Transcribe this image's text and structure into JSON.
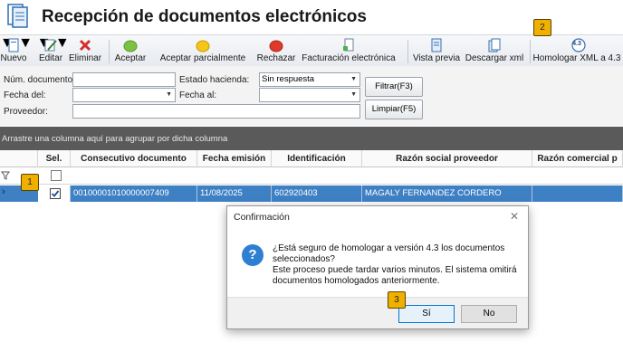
{
  "app": {
    "title": "Recepción de documentos electrónicos"
  },
  "toolbar": {
    "items": [
      {
        "label": "Nuevo",
        "icon": "new-document-icon"
      },
      {
        "label": "Editar",
        "icon": "edit-icon"
      },
      {
        "label": "Eliminar",
        "icon": "delete-icon"
      },
      {
        "label": "Aceptar",
        "icon": "green-circle-icon"
      },
      {
        "label": "Aceptar parcialmente",
        "icon": "yellow-circle-icon"
      },
      {
        "label": "Rechazar",
        "icon": "red-circle-icon"
      },
      {
        "label": "Facturación electrónica",
        "icon": "invoice-icon"
      },
      {
        "label": "Vista previa",
        "icon": "preview-icon"
      },
      {
        "label": "Descargar xml",
        "icon": "download-xml-icon"
      },
      {
        "label": "Homologar XML a 4.3",
        "icon": "homologate-icon",
        "icon_text": "4.3"
      }
    ]
  },
  "filters": {
    "num_documento_label": "Núm. documento:",
    "num_documento_value": "",
    "estado_label": "Estado hacienda:",
    "estado_value": "Sin respuesta",
    "fecha_del_label": "Fecha del:",
    "fecha_del_value": "",
    "fecha_al_label": "Fecha al:",
    "fecha_al_value": "",
    "proveedor_label": "Proveedor:",
    "proveedor_value": "",
    "filtrar_label": "Filtrar(F3)",
    "limpiar_label": "Limpiar(F5)"
  },
  "groupbar": {
    "text": "Arrastre una columna aquí para agrupar por dicha columna"
  },
  "grid": {
    "headers": [
      "Sel.",
      "Consecutivo documento",
      "Fecha emisión",
      "Identificación",
      "Razón social proveedor",
      "Razón comercial p"
    ],
    "row": {
      "selected": true,
      "consecutivo": "00100001010000007409",
      "fecha": "11/08/2025",
      "identificacion": "602920403",
      "razon_social": "MAGALY FERNANDEZ CORDERO",
      "razon_comercial": ""
    }
  },
  "dialog": {
    "title": "Confirmación",
    "icon_glyph": "?",
    "line1": "¿Está seguro de homologar a versión 4.3 los documentos",
    "line2": "seleccionados?",
    "line3": "Este proceso puede tardar varios minutos. El sistema omitirá",
    "line4": "documentos homologados anteriormente.",
    "yes_label": "Sí",
    "no_label": "No",
    "close_glyph": "✕"
  },
  "badges": [
    "1",
    "2",
    "3"
  ],
  "colors": {
    "selected_row": "#3e80c4",
    "badge": "#f0b000",
    "question_icon": "#2e7fd2"
  }
}
